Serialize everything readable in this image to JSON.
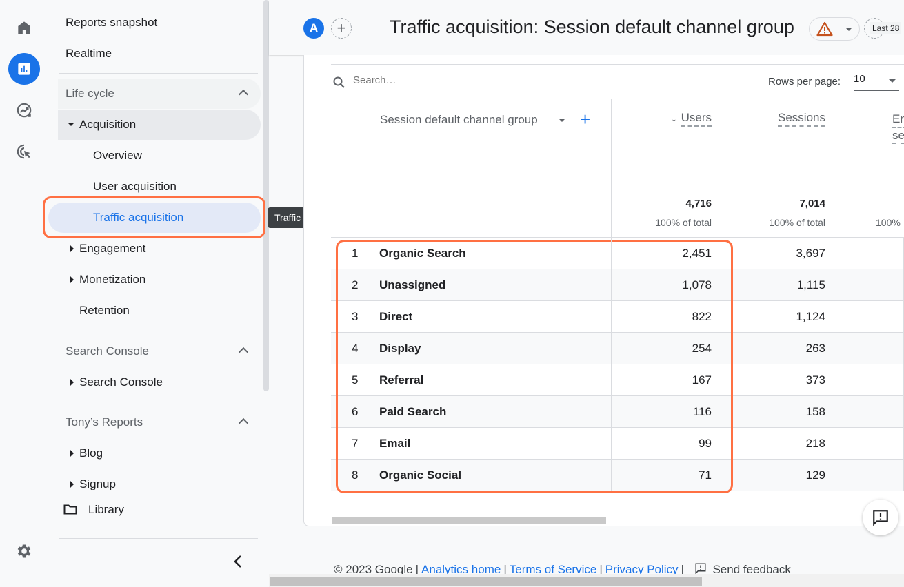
{
  "rail": {
    "items": [
      {
        "name": "home",
        "icon": "home-icon"
      },
      {
        "name": "reports",
        "icon": "reports-icon",
        "active": true
      },
      {
        "name": "explore",
        "icon": "explore-icon"
      },
      {
        "name": "advertising",
        "icon": "advertising-icon"
      }
    ],
    "settings_icon": "gear-icon"
  },
  "sidebar": {
    "top_items": [
      "Reports snapshot",
      "Realtime"
    ],
    "lifecycle": {
      "title": "Life cycle",
      "acquisition": "Acquisition",
      "acquisition_children": [
        "Overview",
        "User acquisition",
        "Traffic acquisition"
      ],
      "selected": "Traffic acquisition",
      "other": [
        "Engagement",
        "Monetization",
        "Retention"
      ]
    },
    "search_console": {
      "title": "Search Console",
      "items": [
        "Search Console"
      ]
    },
    "tonys_reports": {
      "title": "Tony’s Reports",
      "items": [
        "Blog",
        "Signup"
      ]
    },
    "library": "Library"
  },
  "tooltip": "Traffic acquisition",
  "header": {
    "avatar_letter": "A",
    "title": "Traffic acquisition: Session default channel group",
    "date_label": "Last 28"
  },
  "table_controls": {
    "search_placeholder": "Search…",
    "rows_per_page_label": "Rows per page:",
    "rows_per_page_value": "10"
  },
  "table": {
    "dimension_header": "Session default channel group",
    "columns": [
      {
        "label": "Users",
        "sorted": "desc",
        "total": "4,716",
        "pct": "100% of total"
      },
      {
        "label": "Sessions",
        "total": "7,014",
        "pct": "100% of total"
      },
      {
        "label": "En se",
        "total": "",
        "pct": "100%"
      }
    ],
    "rows": [
      {
        "idx": "1",
        "channel": "Organic Search",
        "users": "2,451",
        "sessions": "3,697"
      },
      {
        "idx": "2",
        "channel": "Unassigned",
        "users": "1,078",
        "sessions": "1,115"
      },
      {
        "idx": "3",
        "channel": "Direct",
        "users": "822",
        "sessions": "1,124"
      },
      {
        "idx": "4",
        "channel": "Display",
        "users": "254",
        "sessions": "263"
      },
      {
        "idx": "5",
        "channel": "Referral",
        "users": "167",
        "sessions": "373"
      },
      {
        "idx": "6",
        "channel": "Paid Search",
        "users": "116",
        "sessions": "158"
      },
      {
        "idx": "7",
        "channel": "Email",
        "users": "99",
        "sessions": "218"
      },
      {
        "idx": "8",
        "channel": "Organic Social",
        "users": "71",
        "sessions": "129"
      }
    ]
  },
  "footer": {
    "copyright": "© 2023 Google",
    "links": [
      "Analytics home",
      "Terms of Service",
      "Privacy Policy"
    ],
    "feedback": "Send feedback"
  },
  "colors": {
    "accent": "#1a73e8",
    "highlight": "#ff7043",
    "warning": "#c5521e"
  }
}
